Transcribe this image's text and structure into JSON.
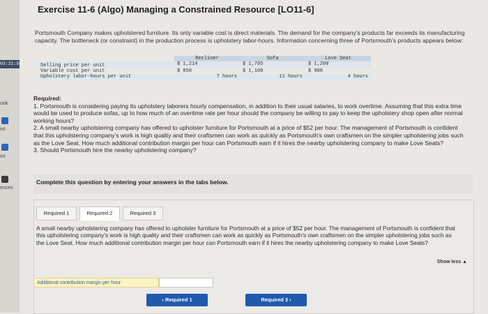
{
  "sidebar": {
    "timer": "03:21:50",
    "items": [
      {
        "label": "ook"
      },
      {
        "label": "int"
      },
      {
        "label": "int"
      },
      {
        "label": "ences"
      }
    ]
  },
  "exercise": {
    "title": "Exercise 11-6 (Algo) Managing a Constrained Resource [LO11-6]",
    "intro": "Portsmouth Company makes upholstered furniture. Its only variable cost is direct materials. The demand for the company's products far exceeds its manufacturing capacity. The bottleneck (or constraint) in the production process is upholstery labor-hours. Information concerning three of Portsmouth's products appears below:"
  },
  "product_table": {
    "columns": [
      "Recliner",
      "Sofa",
      "Love Seat"
    ],
    "rows": [
      {
        "label": "Selling price per unit",
        "values": [
          "$ 1,214",
          "$ 1,705",
          "$ 1,200"
        ]
      },
      {
        "label": "Variable cost per unit",
        "values": [
          "$ 850",
          "$ 1,100",
          "$ 900"
        ]
      },
      {
        "label": "Upholstery labor-hours per unit",
        "values": [
          "7 hours",
          "11 hours",
          "4 hours"
        ]
      }
    ]
  },
  "required": {
    "heading": "Required:",
    "items": [
      "1. Portsmouth is considering paying its upholstery laborers hourly compensation, in addition to their usual salaries, to work overtime. Assuming that this extra time would be used to produce sofas, up to how much of an overtime rate per hour should the company be willing to pay to keep the upholstery shop open after normal working hours?",
      "2. A small nearby upholstering company has offered to upholster furniture for Portsmouth at a price of $52 per hour. The management of Portsmouth is confident that this upholstering company's work is high quality and their craftsmen can work as quickly as Portsmouth's own craftsmen on the simpler upholstering jobs such as the Love Seat. How much additional contribution margin per hour can Portsmouth earn if it hires the nearby upholstering company to make Love Seats?",
      "3. Should Portsmouth hire the nearby upholstering company?"
    ]
  },
  "instructions": "Complete this question by entering your answers in the tabs below.",
  "tabs": [
    {
      "label": "Required 1",
      "active": false
    },
    {
      "label": "Required 2",
      "active": true
    },
    {
      "label": "Required 3",
      "active": false
    }
  ],
  "question_text": "A small nearby upholstering company has offered to upholster furniture for Portsmouth at a price of $52 per hour. The management of Portsmouth is confident that this upholstering company's work is high quality and their craftsmen can work as quickly as Portsmouth's own craftsmen on the simpler upholstering jobs such as the Love Seat. How much additional contribution margin per hour can Portsmouth earn if it hires the nearby upholstering company to make Love Seats?",
  "show_less": "Show less",
  "answer": {
    "label": "Additional contribution margin per hour",
    "value": ""
  },
  "nav": {
    "prev": "Required 1",
    "next": "Required 3"
  },
  "colors": {
    "accent": "#1f5aad",
    "table_header": "#c8d6e2",
    "answer_label_bg": "#fbf3c4"
  }
}
